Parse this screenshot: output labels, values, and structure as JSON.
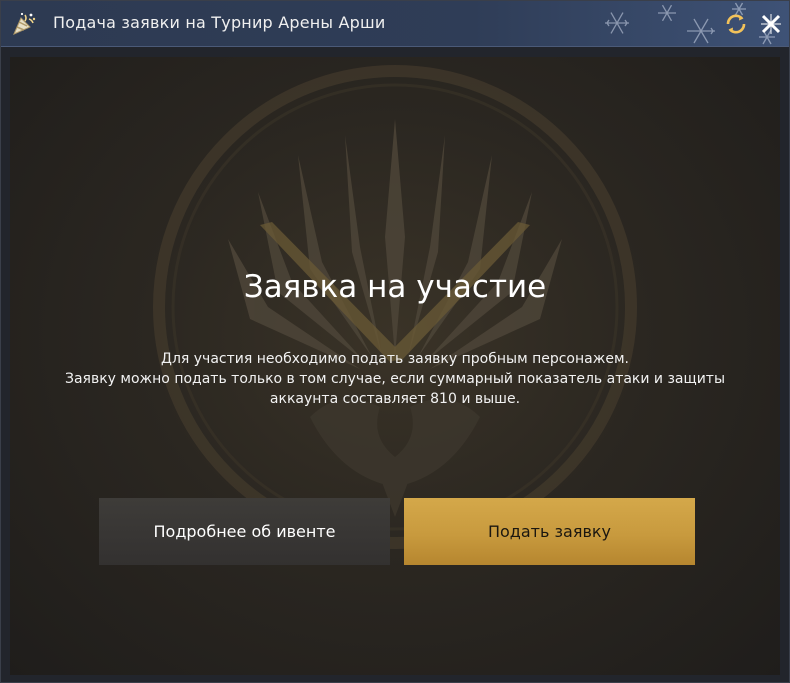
{
  "window": {
    "title": "Подача заявки на Турнир Арены Арши",
    "icons": {
      "title": "party-popper-icon",
      "refresh": "refresh-icon",
      "close": "close-icon",
      "decoration": "snowflake-icon"
    }
  },
  "main": {
    "heading": "Заявка на участие",
    "description_lines": [
      "Для участия необходимо подать заявку пробным персонажем.",
      "Заявку можно подать только в том случае, если суммарный показатель атаки и защиты",
      "аккаунта составляет 810 и выше."
    ],
    "emblem_icon": "arena-sword-emblem-icon"
  },
  "buttons": {
    "info_label": "Подробнее об ивенте",
    "apply_label": "Подать заявку"
  },
  "colors": {
    "titlebar": "#2f3d57",
    "accent_gold": "#c89a3e",
    "button_dark": "#383634"
  }
}
